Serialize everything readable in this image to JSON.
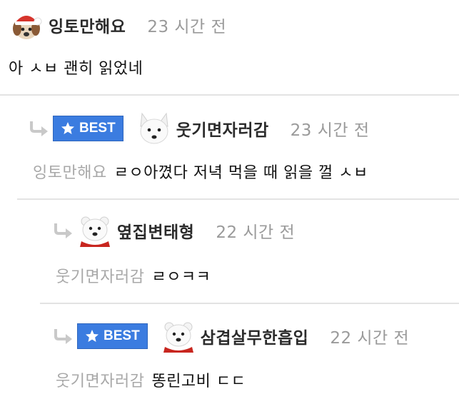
{
  "badge": {
    "best_label": "BEST"
  },
  "comments": [
    {
      "nickname": "잉토만해요",
      "time": "23 시간 전",
      "text": "아 ㅅㅂ 괜히 읽었네",
      "avatar": "puppy-red-hat-avatar"
    },
    {
      "nickname": "웃기면자러감",
      "time": "23 시간 전",
      "mention": "잉토만해요",
      "text": "ㄹㅇ아꼈다 저녁 먹을 때 읽을 껄 ㅅㅂ",
      "best": true,
      "avatar": "white-fox-avatar"
    },
    {
      "nickname": "옆집변태형",
      "time": "22 시간 전",
      "mention": "웃기면자러감",
      "text": "ㄹㅇㅋㅋ",
      "avatar": "polar-bear-red-scarf-avatar"
    },
    {
      "nickname": "삼겹살무한흡입",
      "time": "22 시간 전",
      "mention": "웃기면자러감",
      "text": "똥린고비 ㄷㄷ",
      "best": true,
      "avatar": "polar-bear-red-scarf-avatar"
    }
  ],
  "colors": {
    "best_badge": "#3b7ce0",
    "time_text": "#9a9a9a",
    "mention_text": "#a8a8a8",
    "divider": "#e3e3e3",
    "reply_arrow": "#c9c9c9"
  }
}
